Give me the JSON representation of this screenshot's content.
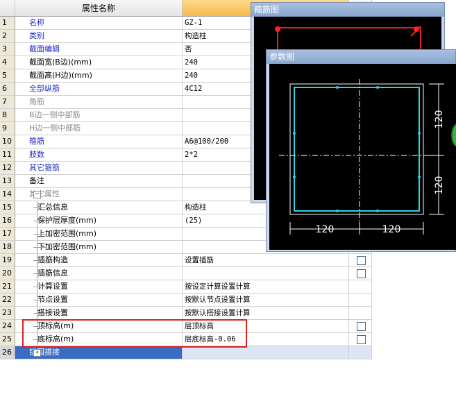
{
  "header": {
    "col_name": "属性名称"
  },
  "rows": [
    {
      "num": "1",
      "name": "名称",
      "value": "GZ-1",
      "style": "blue"
    },
    {
      "num": "2",
      "name": "类别",
      "value": "构造柱",
      "style": "blue"
    },
    {
      "num": "3",
      "name": "截面编辑",
      "value": "否",
      "style": "blue"
    },
    {
      "num": "4",
      "name": "截面宽(B边)(mm)",
      "value": "240",
      "style": "black"
    },
    {
      "num": "5",
      "name": "截面高(H边)(mm)",
      "value": "240",
      "style": "black"
    },
    {
      "num": "6",
      "name": "全部纵筋",
      "value": "4C12",
      "style": "blue"
    },
    {
      "num": "7",
      "name": "角筋",
      "value": "",
      "style": "gray"
    },
    {
      "num": "8",
      "name": "B边一侧中部筋",
      "value": "",
      "style": "gray"
    },
    {
      "num": "9",
      "name": "H边一侧中部筋",
      "value": "",
      "style": "gray"
    },
    {
      "num": "10",
      "name": "箍筋",
      "value": "A6@100/200",
      "style": "blue"
    },
    {
      "num": "11",
      "name": "肢数",
      "value": "2*2",
      "style": "blue"
    },
    {
      "num": "12",
      "name": "其它箍筋",
      "value": "",
      "style": "blue"
    },
    {
      "num": "13",
      "name": "备注",
      "value": "",
      "style": "black"
    },
    {
      "num": "14",
      "name": "其它属性",
      "value": "",
      "style": "gray",
      "expander": "−"
    },
    {
      "num": "15",
      "name": "汇总信息",
      "value": "构造柱",
      "style": "black",
      "tree": true
    },
    {
      "num": "16",
      "name": "保护层厚度(mm)",
      "value": "(25)",
      "style": "black",
      "tree": true
    },
    {
      "num": "17",
      "name": "上加密范围(mm)",
      "value": "",
      "style": "black",
      "tree": true
    },
    {
      "num": "18",
      "name": "下加密范围(mm)",
      "value": "",
      "style": "black",
      "tree": true
    },
    {
      "num": "19",
      "name": "插筋构造",
      "value": "设置插筋",
      "style": "black",
      "tree": true,
      "checkbox": true
    },
    {
      "num": "20",
      "name": "插筋信息",
      "value": "",
      "style": "black",
      "tree": true,
      "checkbox": true
    },
    {
      "num": "21",
      "name": "计算设置",
      "value": "按设定计算设置计算",
      "style": "black",
      "tree": true
    },
    {
      "num": "22",
      "name": "节点设置",
      "value": "按默认节点设置计算",
      "style": "black",
      "tree": true
    },
    {
      "num": "23",
      "name": "搭接设置",
      "value": "按默认搭接设置计算",
      "style": "black",
      "tree": true
    },
    {
      "num": "24",
      "name": "顶标高(m)",
      "value": "层顶标高",
      "style": "black",
      "tree": true,
      "checkbox": true
    },
    {
      "num": "25",
      "name": "底标高(m)",
      "value": "层底标高-0.06",
      "style": "black",
      "tree": true,
      "checkbox": true
    },
    {
      "num": "26",
      "name": "锚固搭接",
      "value": "",
      "style": "blue",
      "expander": "+",
      "selected": true
    }
  ],
  "stirrup_window": {
    "title": "箍筋图"
  },
  "param_window": {
    "title": "参数图",
    "dims": {
      "bottom_left": "120",
      "bottom_right": "120",
      "right_top": "120",
      "right_bottom": "120"
    }
  },
  "colors": {
    "rebar": "#2ad4e6",
    "outline": "#ffffff",
    "highlight": "#e02020",
    "dot": "#ff2020"
  }
}
